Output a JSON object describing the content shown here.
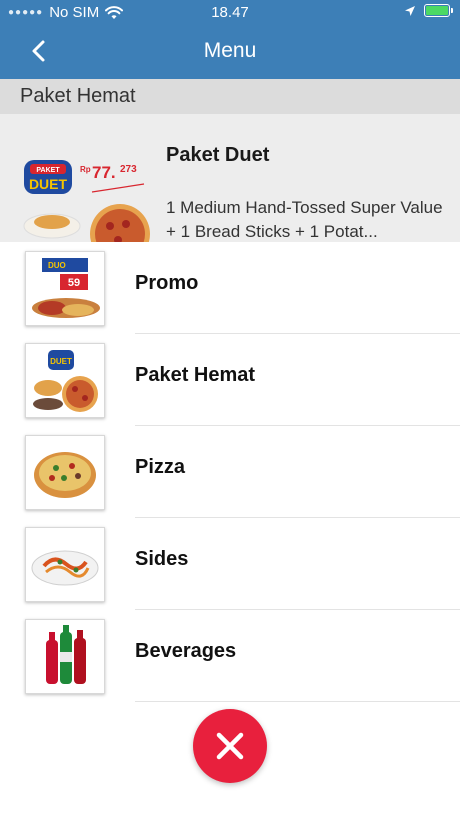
{
  "status_bar": {
    "carrier": "No SIM",
    "time": "18.47"
  },
  "nav": {
    "title": "Menu"
  },
  "section": {
    "title": "Paket Hemat"
  },
  "background_item": {
    "name": "Paket Duet",
    "description": "1 Medium Hand-Tossed Super Value + 1 Bread Sticks + 1 Potat...",
    "promo_brand": "PAKET DUET",
    "promo_price": "Rp 77.273"
  },
  "categories": [
    {
      "label": "Promo",
      "icon": "promo-image"
    },
    {
      "label": "Paket Hemat",
      "icon": "paket-hemat-image"
    },
    {
      "label": "Pizza",
      "icon": "pizza-image"
    },
    {
      "label": "Sides",
      "icon": "sides-image"
    },
    {
      "label": "Beverages",
      "icon": "beverages-image"
    }
  ],
  "colors": {
    "nav_bar": "#3d7fb7",
    "close_button": "#e8203d",
    "section_header": "#dcdcdc"
  }
}
